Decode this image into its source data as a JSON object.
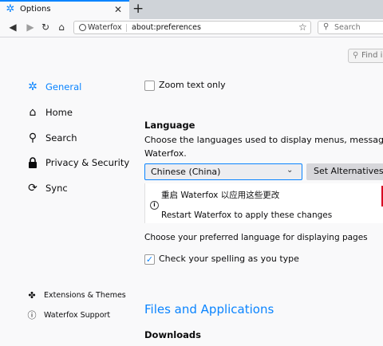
{
  "tab": {
    "title": "Options",
    "close_glyph": "✕",
    "newtab_glyph": "+"
  },
  "navbar": {
    "identity": "Waterfox",
    "url": "about:preferences",
    "search_placeholder": "Search"
  },
  "find": {
    "placeholder": "Find in"
  },
  "sidebar": {
    "items": [
      {
        "label": "General",
        "icon": "gear-icon",
        "selected": true
      },
      {
        "label": "Home",
        "icon": "home-icon"
      },
      {
        "label": "Search",
        "icon": "search-icon"
      },
      {
        "label": "Privacy & Security",
        "icon": "lock-icon"
      },
      {
        "label": "Sync",
        "icon": "sync-icon"
      }
    ],
    "footer": [
      {
        "label": "Extensions & Themes",
        "icon": "puzzle-icon"
      },
      {
        "label": "Waterfox Support",
        "icon": "help-icon"
      }
    ]
  },
  "main": {
    "zoom_text_only": "Zoom text only",
    "language_heading": "Language",
    "language_desc_1": "Choose the languages used to display menus, messages, and n",
    "language_desc_2": "Waterfox.",
    "language_select": "Chinese (China)",
    "set_alternatives": "Set Alternatives...",
    "restart_zh": "重启 Waterfox 以应用这些更改",
    "restart_en": "Restart Waterfox to apply these changes",
    "page_lang": "Choose your preferred language for displaying pages",
    "spell_check": "Check your spelling as you type",
    "files_heading": "Files and Applications",
    "downloads_heading": "Downloads"
  },
  "colors": {
    "accent": "#0a84ff",
    "background": "#f9f9fa"
  }
}
